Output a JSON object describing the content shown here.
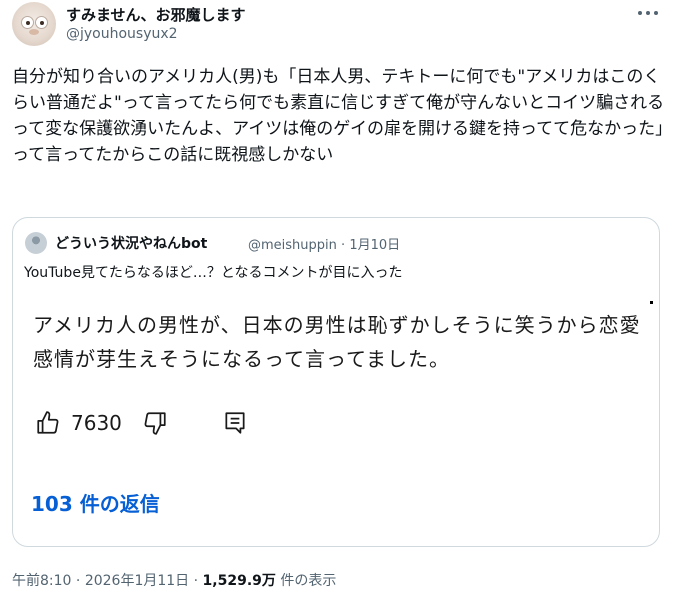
{
  "tweet": {
    "display_name": "すみません、お邪魔します",
    "handle": "@jyouhousyux2",
    "more_icon": "more-icon",
    "text": "自分が知り合いのアメリカ人(男)も「日本人男、テキトーに何でも\"アメリカはこのくらい普通だよ\"って言ってたら何でも素直に信じすぎて俺が守んないとコイツ騙されるって変な保護欲湧いたんよ、アイツは俺のゲイの扉を開ける鍵を持ってて危なかった」って言ってたからこの話に既視感しかない",
    "time": "午前8:10",
    "sep": "·",
    "date": "2026年1月11日",
    "views_count": "1,529.9万",
    "views_label": "件の表示"
  },
  "quoted": {
    "display_name": "どういう状況やねんbot",
    "handle": "@meishuppin",
    "sep": "·",
    "date": "1月10日",
    "text": "YouTube見てたらなるほど…？となるコメントが目に入った",
    "youtube": {
      "comment": "アメリカ人の男性が、日本の男性は恥ずかしそうに笑うから恋愛感情が芽生えそうになるって言ってました。",
      "likes": "7630",
      "replies": "103 件の返信"
    }
  }
}
